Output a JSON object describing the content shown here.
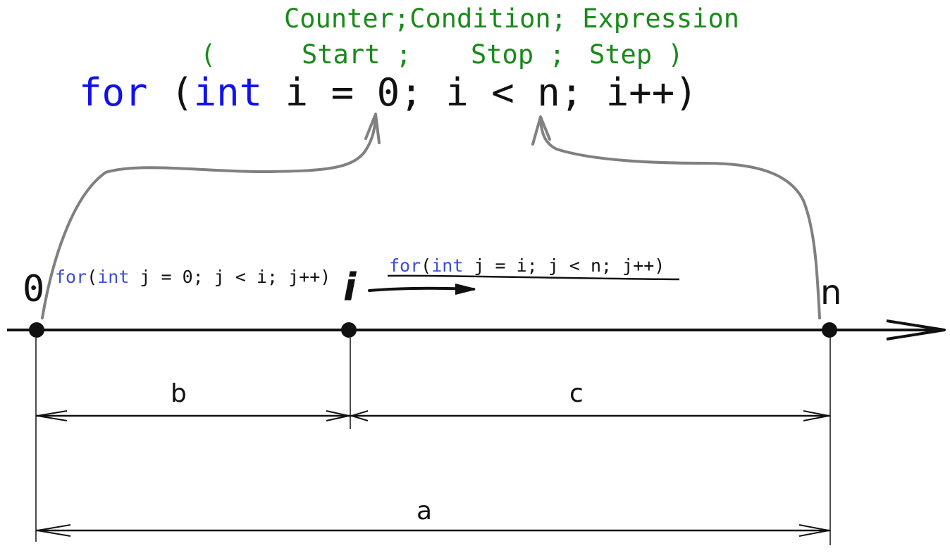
{
  "header": {
    "line1": "Counter;Condition; Expression",
    "line2": {
      "open": "(",
      "start": "Start ;",
      "stop": "Stop ;",
      "step": "Step )"
    }
  },
  "main_code": {
    "kw_for": "for",
    "open": " (",
    "kw_int": "int",
    "rest": " i = 0; i < n; i++)"
  },
  "axis": {
    "label_start": "0",
    "label_i": "i",
    "label_end": "n"
  },
  "inner_loop_left": {
    "kw_for": "for",
    "open": "(",
    "kw_int": "int",
    "rest": " j = 0; j < i; j++)"
  },
  "inner_loop_right": {
    "kw_for": "for",
    "open": "(",
    "kw_int": "int",
    "rest": " j = i; j < n; j++)"
  },
  "dimensions": {
    "b": "b",
    "c": "c",
    "a": "a"
  },
  "colors": {
    "keyword": "#1010ee",
    "keyword_small": "#3b4fd8",
    "header_green": "#1a8a1a",
    "curve_gray": "#808080",
    "ink": "#111111"
  }
}
